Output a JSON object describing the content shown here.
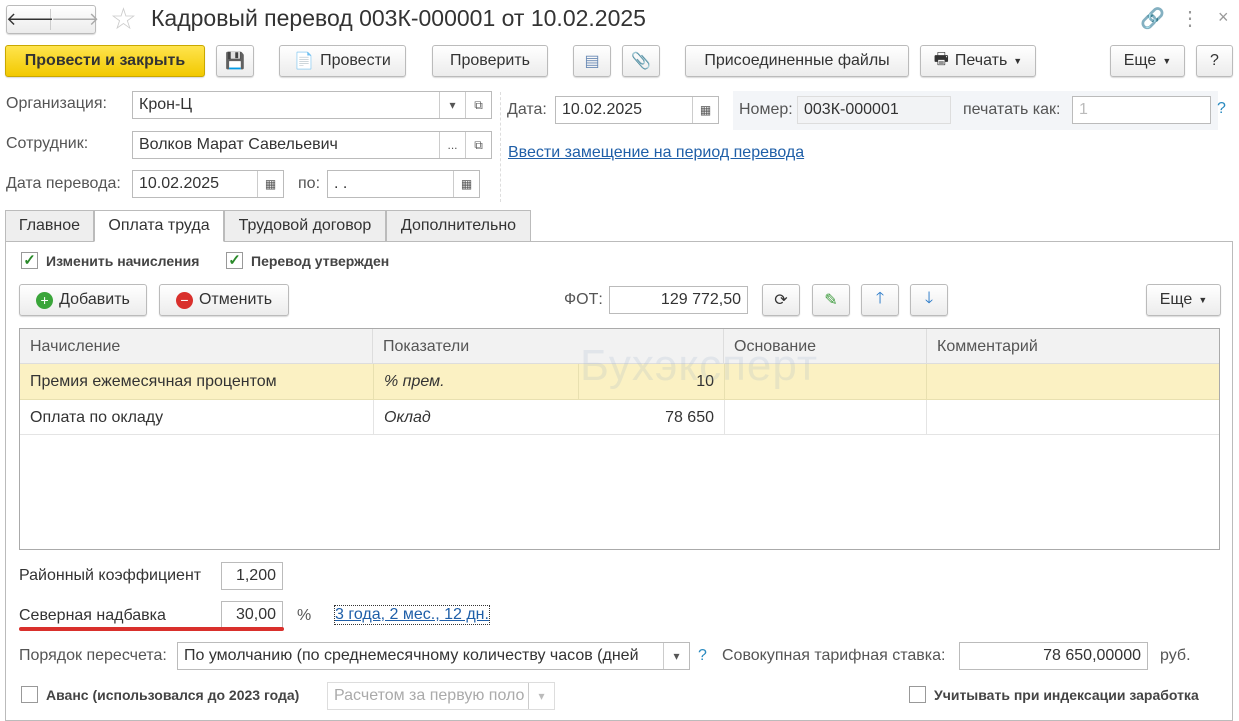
{
  "title": "Кадровый перевод 003К-000001 от 10.02.2025",
  "toolbar": {
    "post_close": "Провести и закрыть",
    "post": "Провести",
    "check": "Проверить",
    "files": "Присоединенные файлы",
    "print": "Печать",
    "more": "Еще",
    "help": "?"
  },
  "header": {
    "org_label": "Организация:",
    "org_value": "Крон-Ц",
    "emp_label": "Сотрудник:",
    "emp_value": "Волков Марат Савельевич",
    "emp_select": "...",
    "transfer_date_label": "Дата перевода:",
    "transfer_date": "10.02.2025",
    "to_label": "по:",
    "to_value": " .  .",
    "date_label": "Дата:",
    "date_value": "10.02.2025",
    "number_label": "Номер:",
    "number_value": "003К-000001",
    "print_as_label": "печатать как:",
    "print_as_value": "1",
    "help": "?",
    "substitution_link": "Ввести замещение на период перевода"
  },
  "tabs": [
    "Главное",
    "Оплата труда",
    "Трудовой договор",
    "Дополнительно"
  ],
  "pay": {
    "change_accruals": "Изменить начисления",
    "change_checked": true,
    "approved": "Перевод утвержден",
    "approved_checked": true,
    "add": "Добавить",
    "cancel": "Отменить",
    "fot_label": "ФОТ:",
    "fot_value": "129 772,50",
    "more": "Еще"
  },
  "table": {
    "headers": [
      "Начисление",
      "Показатели",
      "Основание",
      "Комментарий"
    ],
    "rows": [
      {
        "accrual": "Премия ежемесячная процентом",
        "indicator": "% прем.",
        "value": "10",
        "basis": "",
        "comment": ""
      },
      {
        "accrual": "Оплата по окладу",
        "indicator": "Оклад",
        "value": "78 650",
        "basis": "",
        "comment": ""
      }
    ]
  },
  "watermark": "Бухэксперт",
  "bottom": {
    "district_label": "Районный коэффициент",
    "district_value": "1,200",
    "north_label": "Северная надбавка",
    "north_value": "30,00",
    "percent": "%",
    "north_link": "3 года, 2 мес., 12 дн.",
    "recalc_label": "Порядок пересчета:",
    "recalc_value": "По умолчанию (по среднемесячному количеству часов (дней",
    "recalc_help": "?",
    "rate_label": "Совокупная тарифная ставка:",
    "rate_value": "78 650,00000",
    "rate_unit": "руб.",
    "advance_label": "Аванс (использовался до 2023 года)",
    "advance_value": "Расчетом за первую поло",
    "index_label": "Учитывать при индексации заработка"
  },
  "colors": {
    "accent": "#f5d400",
    "row_highlight": "#fbf1c3",
    "link": "#1f5fa8",
    "underline": "#d9302c"
  }
}
